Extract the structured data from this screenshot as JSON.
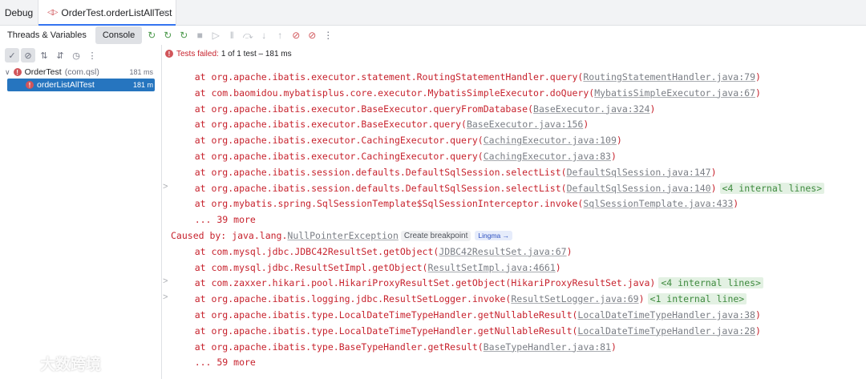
{
  "tabs": {
    "debug_label": "Debug",
    "run_label": "OrderTest.orderListAllTest"
  },
  "toolbar": {
    "threads_label": "Threads & Variables",
    "console_label": "Console",
    "icons": [
      "rerun-icon",
      "rerun-failed-icon",
      "toggle-auto-test-icon",
      "stop-icon",
      "resume-icon",
      "pause-icon",
      "step-over-icon",
      "step-into-icon",
      "step-out-icon",
      "breakpoints-icon",
      "mute-breakpoints-icon",
      "more-icon"
    ]
  },
  "test_tree": {
    "root": {
      "name": "OrderTest",
      "package": "(com.qsl)",
      "duration": "181 ms"
    },
    "child": {
      "name": "orderListAllTest",
      "duration": "181 m"
    }
  },
  "status": {
    "failed_text": "Tests failed:",
    "summary": "1 of 1 test – 181 ms"
  },
  "console": {
    "lines": [
      {
        "gutter": "",
        "text": "    at org.apache.ibatis.executor.statement.RoutingStatementHandler.query(",
        "link": "RoutingStatementHandler.java:79",
        "tail": ")",
        "internal": ""
      },
      {
        "gutter": "",
        "text": "    at com.baomidou.mybatisplus.core.executor.MybatisSimpleExecutor.doQuery(",
        "link": "MybatisSimpleExecutor.java:67",
        "tail": ")",
        "internal": ""
      },
      {
        "gutter": "",
        "text": "    at org.apache.ibatis.executor.BaseExecutor.queryFromDatabase(",
        "link": "BaseExecutor.java:324",
        "tail": ")",
        "internal": ""
      },
      {
        "gutter": "",
        "text": "    at org.apache.ibatis.executor.BaseExecutor.query(",
        "link": "BaseExecutor.java:156",
        "tail": ")",
        "internal": ""
      },
      {
        "gutter": "",
        "text": "    at org.apache.ibatis.executor.CachingExecutor.query(",
        "link": "CachingExecutor.java:109",
        "tail": ")",
        "internal": ""
      },
      {
        "gutter": "",
        "text": "    at org.apache.ibatis.executor.CachingExecutor.query(",
        "link": "CachingExecutor.java:83",
        "tail": ")",
        "internal": ""
      },
      {
        "gutter": "",
        "text": "    at org.apache.ibatis.session.defaults.DefaultSqlSession.selectList(",
        "link": "DefaultSqlSession.java:147",
        "tail": ")",
        "internal": ""
      },
      {
        "gutter": ">",
        "text": "    at org.apache.ibatis.session.defaults.DefaultSqlSession.selectList(",
        "link": "DefaultSqlSession.java:140",
        "tail": ")",
        "internal": "<4 internal lines>"
      },
      {
        "gutter": "",
        "text": "    at org.mybatis.spring.SqlSessionTemplate$SqlSessionInterceptor.invoke(",
        "link": "SqlSessionTemplate.java:433",
        "tail": ")",
        "internal": ""
      },
      {
        "gutter": "",
        "text": "    ... 39 more",
        "link": "",
        "tail": "",
        "internal": ""
      }
    ],
    "caused_by": {
      "prefix": "Caused by: java.lang.",
      "exception": "NullPointerException",
      "create_breakpoint": "Create breakpoint",
      "lingma": "Lingma →"
    },
    "lines2": [
      {
        "gutter": "",
        "text": "    at com.mysql.jdbc.JDBC42ResultSet.getObject(",
        "link": "JDBC42ResultSet.java:67",
        "tail": ")",
        "internal": ""
      },
      {
        "gutter": "",
        "text": "    at com.mysql.jdbc.ResultSetImpl.getObject(",
        "link": "ResultSetImpl.java:4661",
        "tail": ")",
        "internal": ""
      },
      {
        "gutter": ">",
        "text": "    at com.zaxxer.hikari.pool.HikariProxyResultSet.getObject(HikariProxyResultSet.java)",
        "link": "",
        "tail": "",
        "internal": "<4 internal lines>"
      },
      {
        "gutter": ">",
        "text": "    at org.apache.ibatis.logging.jdbc.ResultSetLogger.invoke(",
        "link": "ResultSetLogger.java:69",
        "tail": ")",
        "internal": "<1 internal line>"
      },
      {
        "gutter": "",
        "text": "    at org.apache.ibatis.type.LocalDateTimeTypeHandler.getNullableResult(",
        "link": "LocalDateTimeTypeHandler.java:38",
        "tail": ")",
        "internal": ""
      },
      {
        "gutter": "",
        "text": "    at org.apache.ibatis.type.LocalDateTimeTypeHandler.getNullableResult(",
        "link": "LocalDateTimeTypeHandler.java:28",
        "tail": ")",
        "internal": ""
      },
      {
        "gutter": "",
        "text": "    at org.apache.ibatis.type.BaseTypeHandler.getResult(",
        "link": "BaseTypeHandler.java:81",
        "tail": ")",
        "internal": ""
      },
      {
        "gutter": "",
        "text": "    ... 59 more",
        "link": "",
        "tail": "",
        "internal": ""
      }
    ]
  },
  "watermark": {
    "text": "大数跨境"
  }
}
